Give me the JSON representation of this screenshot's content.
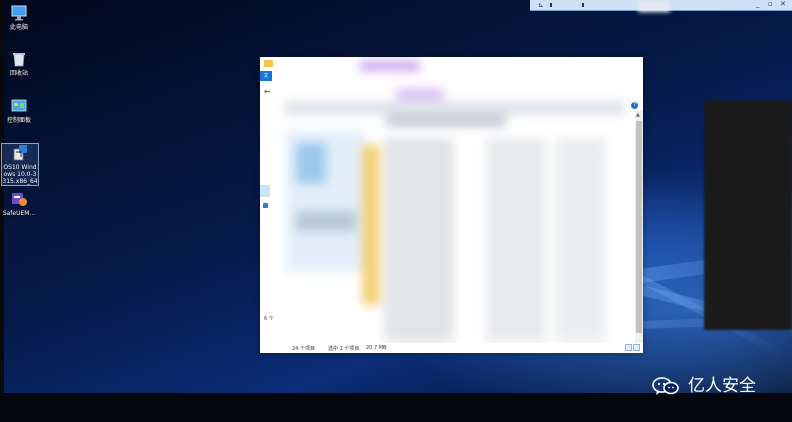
{
  "desktop": {
    "icons": [
      {
        "label": "此电脑",
        "icon": "computer-icon"
      },
      {
        "label": "回收站",
        "icon": "recycle-bin-icon"
      },
      {
        "label": "控制面板",
        "icon": "control-panel-icon"
      },
      {
        "label": "OS10 Windows 10.0-3315.x86_64",
        "icon": "installer-icon"
      },
      {
        "label": "SafeUEM...",
        "icon": "safeuem-icon"
      }
    ]
  },
  "remote_bar": {
    "pin": "⊾",
    "controls": [
      "_",
      "▫",
      "✕"
    ],
    "colors": {
      "background": "#cfe0f5",
      "accent": "#1b3a6b"
    }
  },
  "explorer": {
    "ribbon_tab": "文",
    "back_arrow": "←",
    "nav_dot_glyph": "●",
    "help": "?",
    "left_count": "6 个",
    "status": {
      "items": "24 个项目",
      "selected": "选中 1 个项目",
      "size": "20.7 MB"
    },
    "colors": {
      "accent": "#1a73d6",
      "folder": "#f3c54b"
    }
  },
  "watermark": {
    "text": "亿人安全",
    "icon": "wechat-icon"
  }
}
